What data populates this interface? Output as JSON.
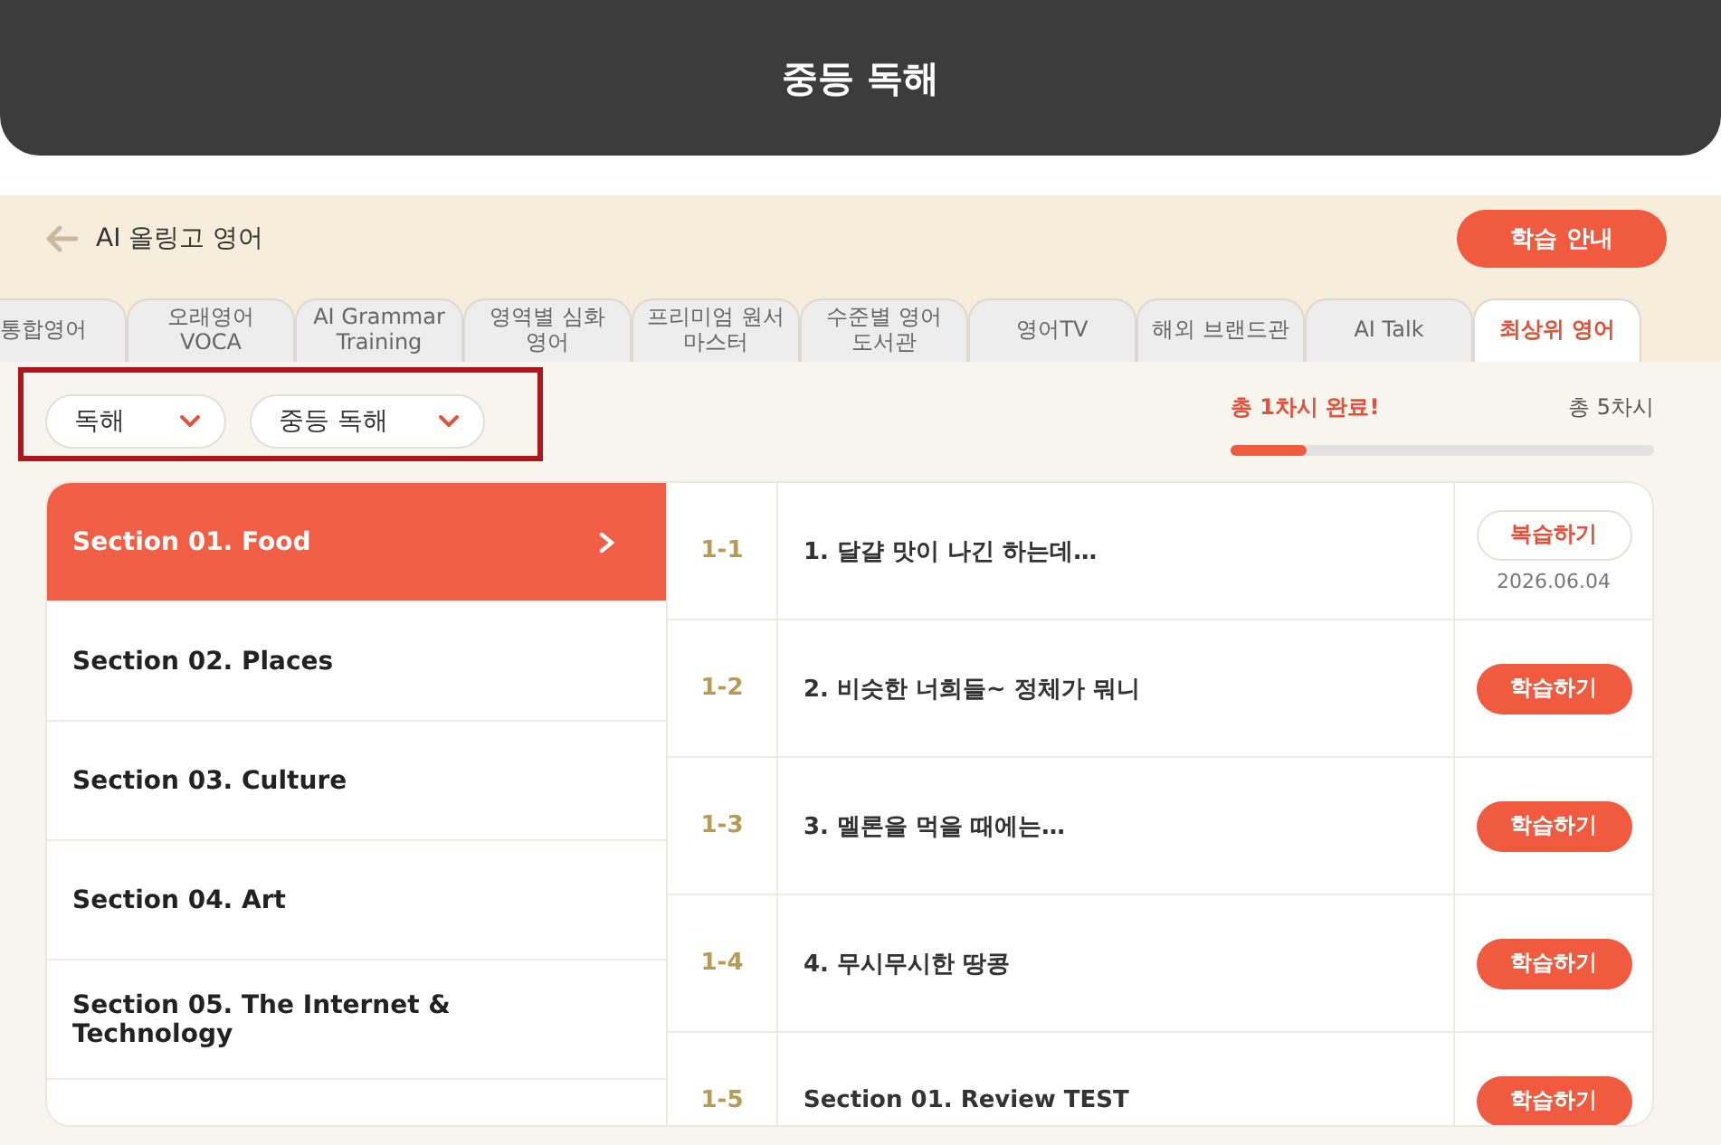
{
  "title_bar": {
    "title": "중등 독해"
  },
  "header": {
    "back_label": "AI 올링고 영어",
    "guide_button": "학습 안내"
  },
  "tabs": [
    {
      "label": "통합영어",
      "selected": false
    },
    {
      "label": "오래영어 VOCA",
      "selected": false
    },
    {
      "label": "AI Grammar Training",
      "selected": false
    },
    {
      "label": "영역별 심화 영어",
      "selected": false
    },
    {
      "label": "프리미엄 원서 마스터",
      "selected": false
    },
    {
      "label": "수준별 영어 도서관",
      "selected": false
    },
    {
      "label": "영어TV",
      "selected": false
    },
    {
      "label": "해외 브랜드관",
      "selected": false
    },
    {
      "label": "AI Talk",
      "selected": false
    },
    {
      "label": "최상위 영어",
      "selected": true
    }
  ],
  "filters": [
    {
      "value": "독해"
    },
    {
      "value": "중등 독해"
    }
  ],
  "progress": {
    "status": "총 1차시 완료!",
    "total": "총 5차시",
    "level": 0.18
  },
  "sections": [
    {
      "label": "Section 01. Food",
      "selected": true
    },
    {
      "label": "Section 02. Places",
      "selected": false
    },
    {
      "label": "Section 03. Culture",
      "selected": false
    },
    {
      "label": "Section 04. Art",
      "selected": false
    },
    {
      "label": "Section 05. The Internet & Technology",
      "selected": false
    }
  ],
  "lessons": [
    {
      "number": "1-1",
      "title": "1. 달걀 맛이 나긴 하는데…",
      "kind": "review",
      "button": "복습하기",
      "date": "2026.06.04"
    },
    {
      "number": "1-2",
      "title": "2. 비슷한 너희들~ 정체가 뭐니",
      "kind": "study",
      "button": "학습하기"
    },
    {
      "number": "1-3",
      "title": "3. 멜론을 먹을 때에는…",
      "kind": "study",
      "button": "학습하기"
    },
    {
      "number": "1-4",
      "title": "4. 무시무시한 땅콩",
      "kind": "study",
      "button": "학습하기"
    },
    {
      "number": "1-5",
      "title": "Section 01. Review TEST",
      "kind": "study",
      "button": "학습하기"
    }
  ]
}
